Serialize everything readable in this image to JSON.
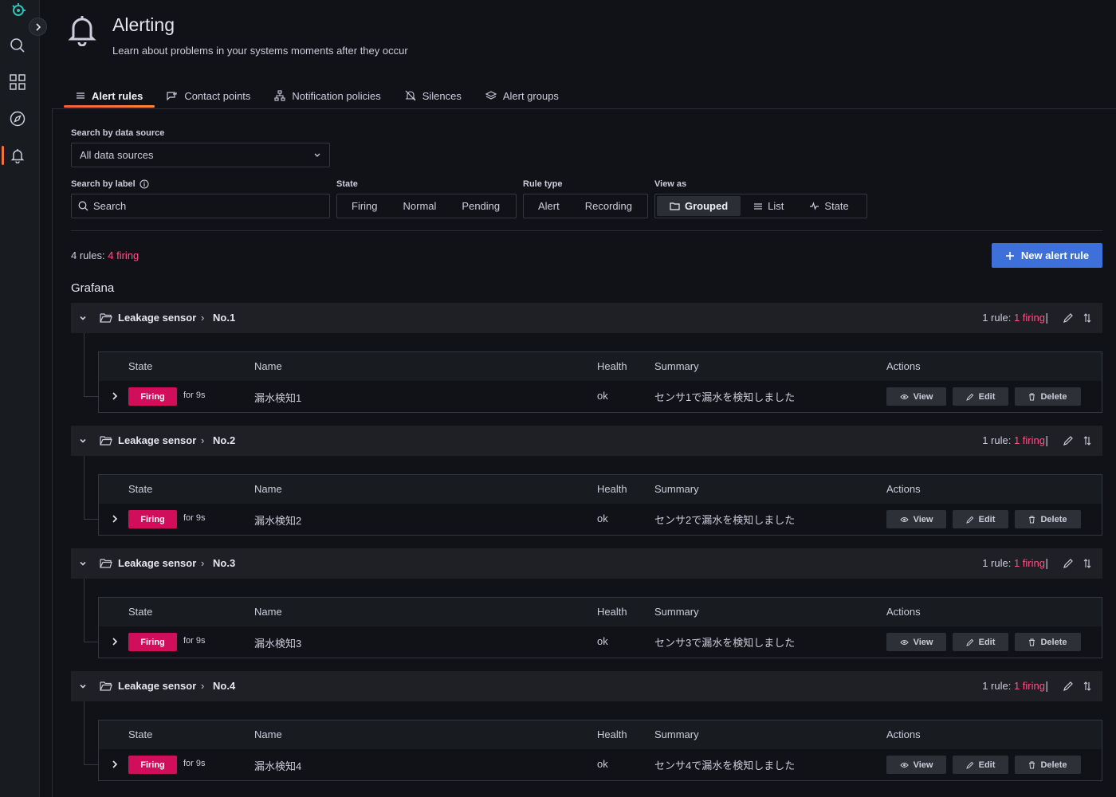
{
  "header": {
    "title": "Alerting",
    "subtitle": "Learn about problems in your systems moments after they occur"
  },
  "tabs": [
    {
      "label": "Alert rules",
      "icon": "list-icon",
      "active": true
    },
    {
      "label": "Contact points",
      "icon": "comment-alt-share-icon",
      "active": false
    },
    {
      "label": "Notification policies",
      "icon": "sitemap-icon",
      "active": false
    },
    {
      "label": "Silences",
      "icon": "bell-slash-icon",
      "active": false
    },
    {
      "label": "Alert groups",
      "icon": "layer-group-icon",
      "active": false
    }
  ],
  "filters": {
    "datasource_label": "Search by data source",
    "datasource_value": "All data sources",
    "label_label": "Search by label",
    "search_placeholder": "Search",
    "state_label": "State",
    "state_options": [
      "Firing",
      "Normal",
      "Pending"
    ],
    "rule_type_label": "Rule type",
    "rule_type_options": [
      "Alert",
      "Recording"
    ],
    "view_as_label": "View as",
    "view_options": [
      {
        "label": "Grouped",
        "icon": "folder-icon",
        "active": true
      },
      {
        "label": "List",
        "icon": "list-icon",
        "active": false
      },
      {
        "label": "State",
        "icon": "heart-rate-icon",
        "active": false
      }
    ]
  },
  "summary": {
    "count_text": "4 rules:",
    "firing_text": "4 firing"
  },
  "new_rule_button": "New alert rule",
  "section_title": "Grafana",
  "table_headers": {
    "state": "State",
    "name": "Name",
    "health": "Health",
    "summary": "Summary",
    "actions": "Actions"
  },
  "action_labels": {
    "view": "View",
    "edit": "Edit",
    "delete": "Delete"
  },
  "groups": [
    {
      "namespace": "Leakage sensor",
      "separator": "›",
      "name": "No.1",
      "rule_count": "1 rule:",
      "firing": "1 firing",
      "rule": {
        "state": "Firing",
        "duration": "for 9s",
        "name": "漏水検知1",
        "health": "ok",
        "summary": "センサ1で漏水を検知しました"
      }
    },
    {
      "namespace": "Leakage sensor",
      "separator": "›",
      "name": "No.2",
      "rule_count": "1 rule:",
      "firing": "1 firing",
      "rule": {
        "state": "Firing",
        "duration": "for 9s",
        "name": "漏水検知2",
        "health": "ok",
        "summary": "センサ2で漏水を検知しました"
      }
    },
    {
      "namespace": "Leakage sensor",
      "separator": "›",
      "name": "No.3",
      "rule_count": "1 rule:",
      "firing": "1 firing",
      "rule": {
        "state": "Firing",
        "duration": "for 9s",
        "name": "漏水検知3",
        "health": "ok",
        "summary": "センサ3で漏水を検知しました"
      }
    },
    {
      "namespace": "Leakage sensor",
      "separator": "›",
      "name": "No.4",
      "rule_count": "1 rule:",
      "firing": "1 firing",
      "rule": {
        "state": "Firing",
        "duration": "for 9s",
        "name": "漏水検知4",
        "health": "ok",
        "summary": "センサ4で漏水を検知しました"
      }
    }
  ],
  "colors": {
    "accent": "#3d71d9",
    "firing": "#d10e5c",
    "firing_text": "#ff5286",
    "active_tab": "#f55f3e"
  }
}
